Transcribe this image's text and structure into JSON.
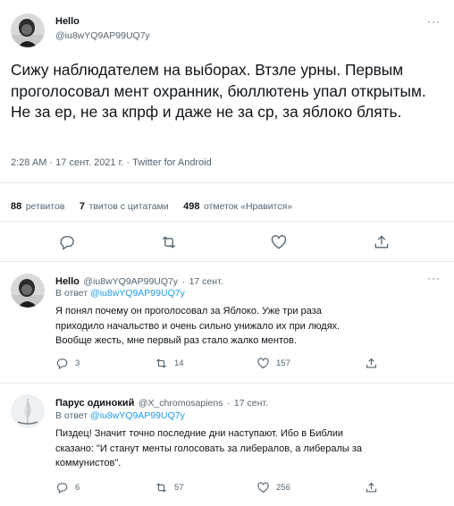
{
  "main_tweet": {
    "author_name": "Hello",
    "author_handle": "@iu8wYQ9AP99UQ7y",
    "more": "···",
    "text": "Сижу наблюдателем на выборах. Втзле урны. Первым проголосовал мент охранник, бюллютень упал открытым. Не за ер, не за кпрф и даже не за ср, за яблоко блять.",
    "time": "2:28 AM",
    "date": "17 сент. 2021 г.",
    "source": "Twitter for Android",
    "separator": "·",
    "retweets_count": "88",
    "retweets_label": "ретвитов",
    "quotes_count": "7",
    "quotes_label": "твитов с цитатами",
    "likes_count": "498",
    "likes_label": "отметок «Нравится»"
  },
  "replies": [
    {
      "author_name": "Hello",
      "author_handle": "@iu8wYQ9AP99UQ7y",
      "date": "17 сент.",
      "reply_prefix": "В ответ",
      "reply_to": "@iu8wYQ9AP99UQ7y",
      "lines": [
        "Я понял почему он проголосовал за Яблоко. Уже три раза",
        "приходило начальство и очень сильно унижало их при людях.",
        "Вообще жесть, мне первый раз стало жалко ментов."
      ],
      "reply_count": "3",
      "retweet_count": "14",
      "like_count": "157"
    },
    {
      "author_name": "Парус одинокий",
      "author_handle": "@X_chromosapiens",
      "date": "17 сент.",
      "reply_prefix": "В ответ",
      "reply_to": "@iu8wYQ9AP99UQ7y",
      "lines": [
        "Пиздец! Значит точно последние дни наступают. Ибо в Библии",
        "сказано: \"И станут менты голосовать за либералов, а либералы за",
        "коммунистов\"."
      ],
      "reply_count": "6",
      "retweet_count": "57",
      "like_count": "256"
    }
  ],
  "colors": {
    "text": "#0f1419",
    "secondary": "#536471",
    "link": "#1d9bf0",
    "divider": "#e7ebed"
  },
  "icons": [
    "reply-icon",
    "retweet-icon",
    "like-icon",
    "share-icon",
    "more-icon"
  ]
}
